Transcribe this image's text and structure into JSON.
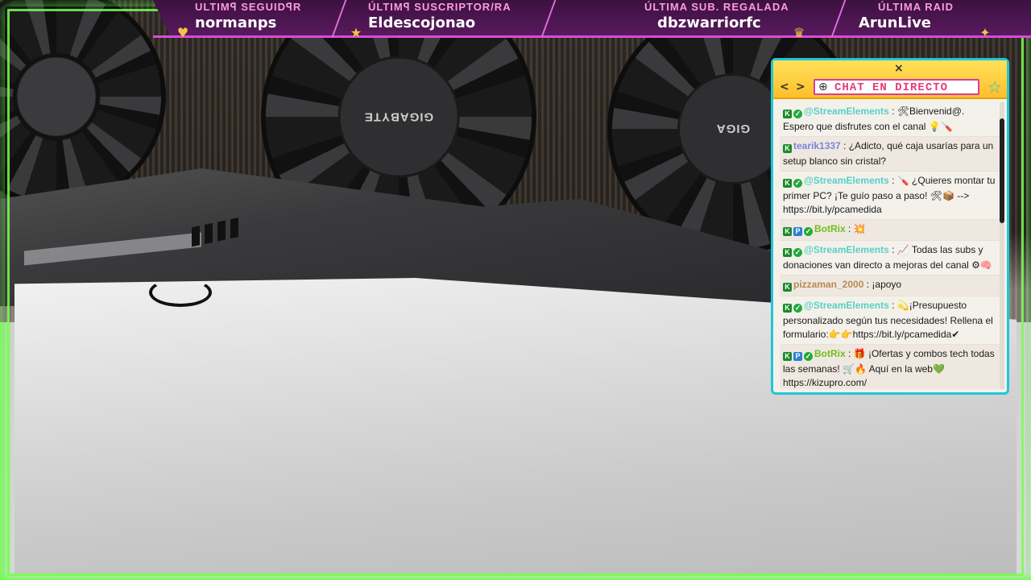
{
  "alerts": [
    {
      "title": "ULTIMꟼ SEGUIDꟼR",
      "value": "normanps",
      "icon": "heart-icon"
    },
    {
      "title": "ÚLTIMꟼ SUSCRIPTOR/RA",
      "value": "Eldescojonao",
      "icon": "star-icon"
    },
    {
      "title": "ÚLTIMA SUB. REGALADA",
      "value": "dbzwarriorfc",
      "icon": "trophy-icon"
    },
    {
      "title": "ÚLTIMA RAID",
      "value": "ArunLive",
      "icon": "gift-icon"
    }
  ],
  "scene": {
    "fan_brand": "GIGABYTE",
    "fan_brand_partial": "GIGA"
  },
  "chat": {
    "close": "×",
    "prev": "<",
    "next": ">",
    "title": "CHAT EN DIRECTO",
    "star": "☆",
    "messages": [
      {
        "user": "@StreamElements",
        "color": "green",
        "badges": [
          "k",
          "v"
        ],
        "text": ": 🛠Bienvenid@. Espero que disfrutes con el canal 💡🪛"
      },
      {
        "user": "tearik1337",
        "color": "blue",
        "badges": [
          "k"
        ],
        "text": ": ¿Adicto, qué caja usarías para un setup blanco sin cristal?"
      },
      {
        "user": "@StreamElements",
        "color": "green",
        "badges": [
          "k",
          "v"
        ],
        "text": ": 🪛 ¿Quieres montar tu primer PC? ¡Te guío paso a paso! 🛠📦 --> https://bit.ly/pcamedida"
      },
      {
        "user": "BotRix",
        "color": "lime",
        "badges": [
          "k",
          "p",
          "v"
        ],
        "text": ": 💥"
      },
      {
        "user": "@StreamElements",
        "color": "green",
        "badges": [
          "k",
          "v"
        ],
        "text": ": 📈 Todas las subs y donaciones van directo a mejoras del canal ⚙🧠"
      },
      {
        "user": "pizzaman_2000",
        "color": "brown",
        "badges": [
          "k"
        ],
        "text": ": ¡apoyo"
      },
      {
        "user": "@StreamElements",
        "color": "green",
        "badges": [
          "k",
          "v"
        ],
        "text": ": 💫¡Presupuesto personalizado según tus necesidades! Rellena el formulario:👉👉https://bit.ly/pcamedida✔"
      },
      {
        "user": "BotRix",
        "color": "lime",
        "badges": [
          "k",
          "p",
          "v"
        ],
        "text": ": 🎁 ¡Ofertas y combos tech todas las semanas! 🛒🔥 Aquí en la web💚 https://kizupro.com/"
      }
    ]
  }
}
